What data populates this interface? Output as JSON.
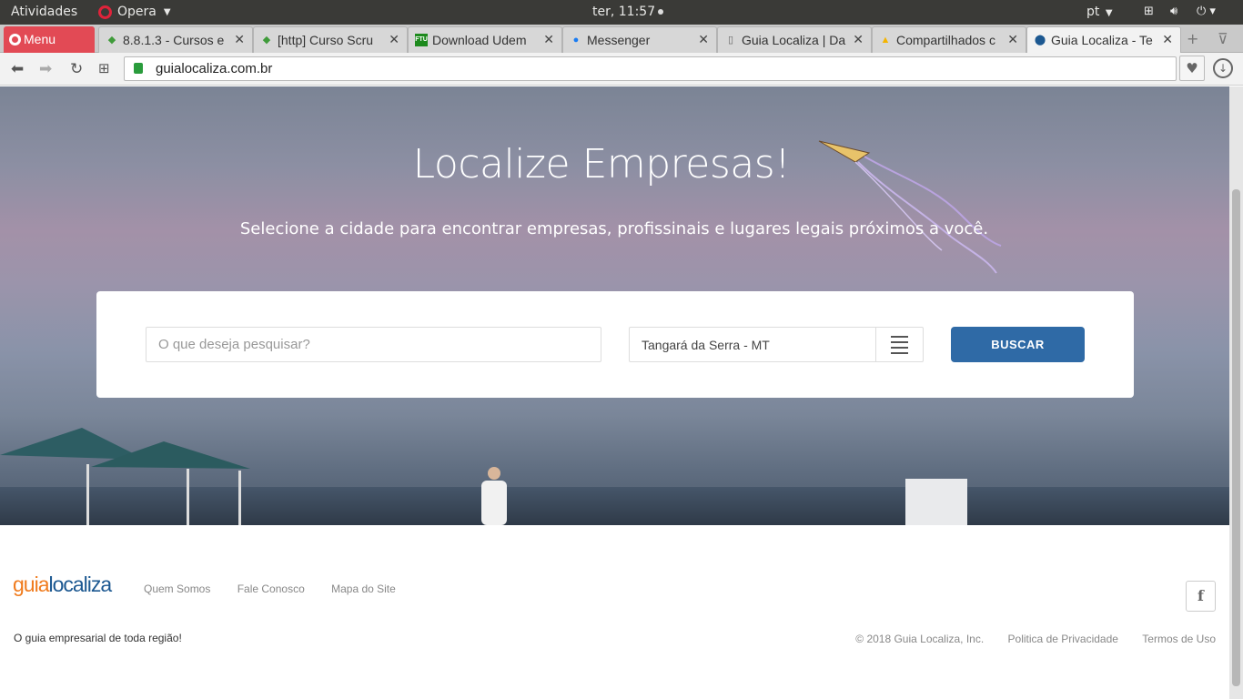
{
  "system": {
    "activities": "Atividades",
    "app_name": "Opera",
    "clock": "ter, 11:57",
    "lang": "pt"
  },
  "browser": {
    "menu_label": "Menu",
    "tabs": [
      {
        "label": "8.8.1.3 - Cursos e",
        "icon": "green-diamond-icon"
      },
      {
        "label": "[http] Curso Scru",
        "icon": "green-diamond-icon"
      },
      {
        "label": "Download Udem",
        "icon": "ftu-icon"
      },
      {
        "label": "Messenger",
        "icon": "messenger-icon"
      },
      {
        "label": "Guia Localiza | Da",
        "icon": "document-icon"
      },
      {
        "label": "Compartilhados c",
        "icon": "google-drive-icon"
      },
      {
        "label": "Guia Localiza - Te",
        "icon": "location-pin-icon"
      }
    ],
    "url": "guialocaliza.com.br"
  },
  "hero": {
    "title": "Localize Empresas!",
    "subtitle": "Selecione a cidade para encontrar empresas, profissinais e lugares legais próximos a você.",
    "search_placeholder": "O que deseja pesquisar?",
    "city_value": "Tangará da Serra - MT",
    "search_button": "BUSCAR"
  },
  "footer": {
    "logo_part1": "guia",
    "logo_part2": "localiza",
    "links": [
      "Quem Somos",
      "Fale Conosco",
      "Mapa do Site"
    ],
    "tagline": "O guia empresarial de toda região!",
    "copyright": "© 2018 Guia Localiza, Inc.",
    "privacy": "Politica de Privacidade",
    "terms": "Termos de Uso"
  },
  "colors": {
    "brand_orange": "#f07b1d",
    "brand_blue": "#1c5891",
    "button_blue": "#2f6aa6"
  }
}
